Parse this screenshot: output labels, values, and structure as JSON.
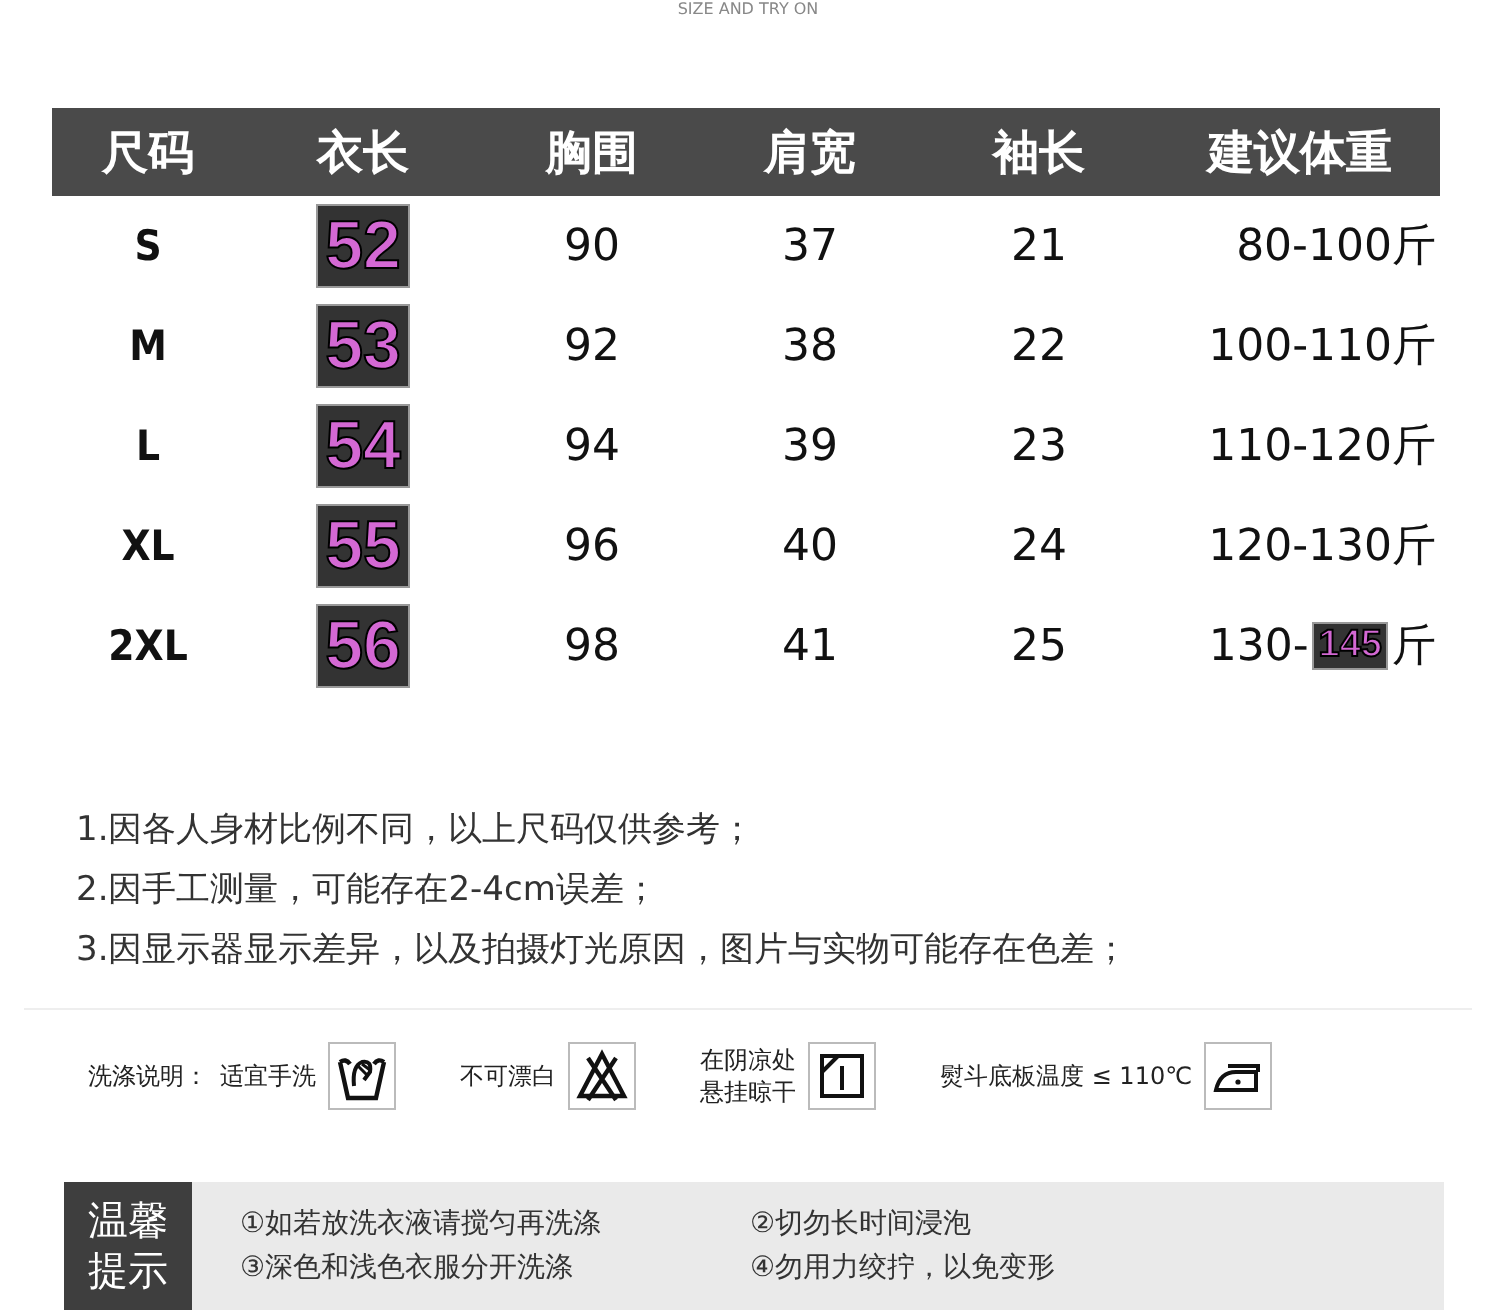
{
  "caption": "SIZE AND TRY ON",
  "table": {
    "columns": [
      "尺码",
      "衣长",
      "胸围",
      "肩宽",
      "袖长",
      "建议体重"
    ],
    "rows": [
      {
        "size": "S",
        "length": {
          "text": "52",
          "highlighted": true
        },
        "chest": "90",
        "shoulder": "37",
        "sleeve": "21",
        "weight": [
          {
            "text": "80-100斤",
            "highlighted": false
          }
        ]
      },
      {
        "size": "M",
        "length": {
          "text": "53",
          "highlighted": true
        },
        "chest": "92",
        "shoulder": "38",
        "sleeve": "22",
        "weight": [
          {
            "text": "100-110斤",
            "highlighted": false
          }
        ]
      },
      {
        "size": "L",
        "length": {
          "text": "54",
          "highlighted": true
        },
        "chest": "94",
        "shoulder": "39",
        "sleeve": "23",
        "weight": [
          {
            "text": "110-120斤",
            "highlighted": false
          }
        ]
      },
      {
        "size": "XL",
        "length": {
          "text": "55",
          "highlighted": true
        },
        "chest": "96",
        "shoulder": "40",
        "sleeve": "24",
        "weight": [
          {
            "text": "120-130斤",
            "highlighted": false
          }
        ]
      },
      {
        "size": "2XL",
        "length": {
          "text": "56",
          "highlighted": true
        },
        "chest": "98",
        "shoulder": "41",
        "sleeve": "25",
        "weight": [
          {
            "text": "130-",
            "highlighted": false
          },
          {
            "text": "145",
            "highlighted": true
          },
          {
            "text": "斤",
            "highlighted": false
          }
        ]
      }
    ]
  },
  "notes": [
    "1.因各人身材比例不同，以上尺码仅供参考；",
    "2.因手工测量，可能存在2-4cm误差；",
    "3.因显示器显示差异，以及拍摄灯光原因，图片与实物可能存在色差；"
  ],
  "care": {
    "title": "洗涤说明：",
    "items": [
      {
        "kind": "handwash",
        "label": "适宜手洗"
      },
      {
        "kind": "nobleach",
        "label": "不可漂白"
      },
      {
        "kind": "shadedry",
        "label": "在阴凉处悬挂晾干"
      },
      {
        "kind": "iron",
        "label": "熨斗底板温度 ≤ 110℃"
      }
    ]
  },
  "tips": {
    "title": "温馨提示",
    "items": [
      "①如若放洗衣液请搅匀再洗涤",
      "②切勿长时间浸泡",
      "③深色和浅色衣服分开洗涤",
      "④勿用力绞拧，以免变形"
    ]
  }
}
